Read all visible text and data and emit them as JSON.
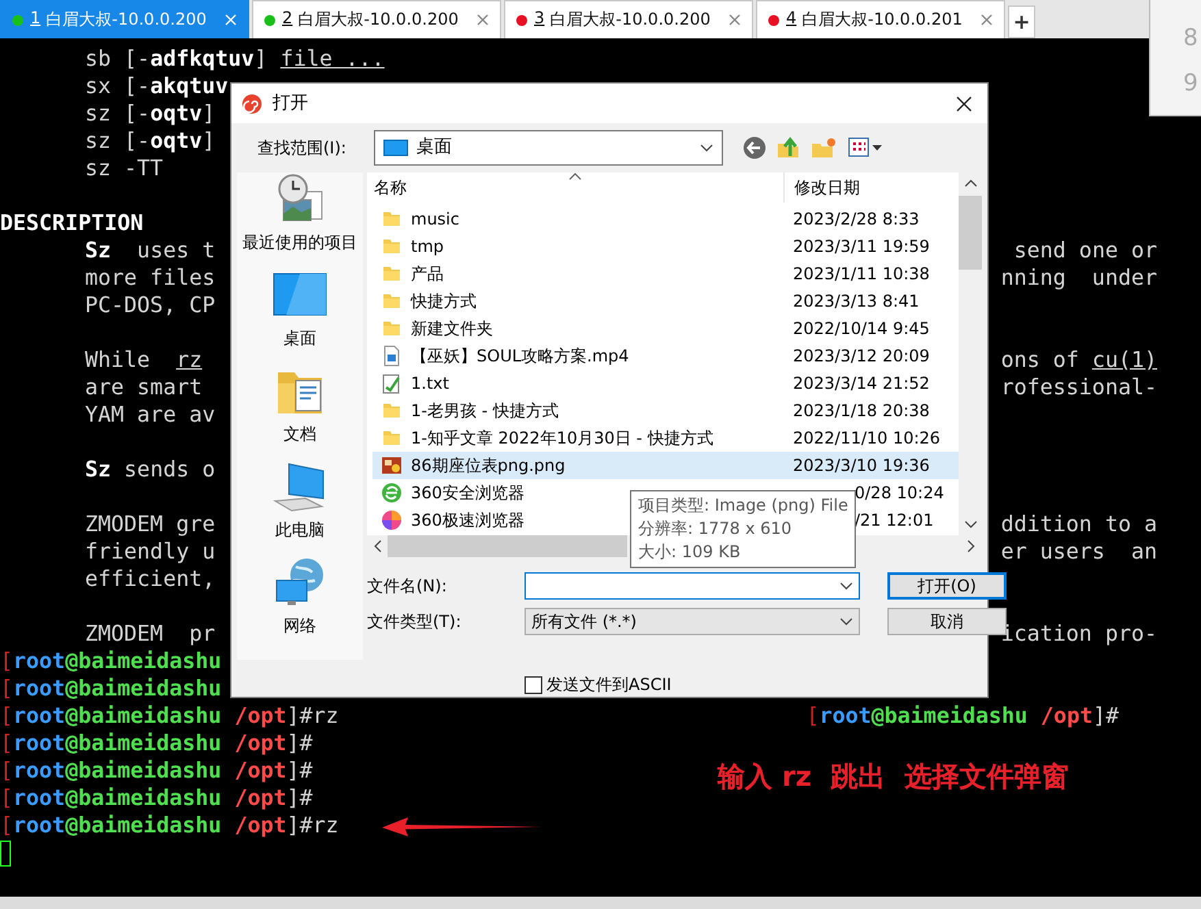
{
  "tabs": [
    {
      "number": "1",
      "title": "白眉大叔-10.0.0.200",
      "color": "#19c019",
      "selected": true
    },
    {
      "number": "2",
      "title": "白眉大叔-10.0.0.200",
      "color": "#19c019",
      "selected": false
    },
    {
      "number": "3",
      "title": "白眉大叔-10.0.0.200",
      "color": "#e81123",
      "selected": false
    },
    {
      "number": "4",
      "title": "白眉大叔-10.0.0.201",
      "color": "#e81123",
      "selected": false
    }
  ],
  "new_tab": "+",
  "side_panel": {
    "numbers": [
      "8",
      "9"
    ]
  },
  "terminal": {
    "blocks": [
      {
        "lines": [
          {
            "kind": "text",
            "left": [
              {
                "text": "sb [-",
                "kind": "plain"
              },
              {
                "text": "adfkqtuv",
                "kind": "bold"
              },
              {
                "text": "] ",
                "kind": "plain"
              },
              {
                "text": "file ...",
                "kind": "underlined"
              }
            ]
          },
          {
            "kind": "text",
            "left": [
              {
                "text": "sx [-",
                "kind": "plain"
              },
              {
                "text": "akqtuv",
                "kind": "bold"
              }
            ]
          },
          {
            "kind": "text",
            "left": [
              {
                "text": "sz [-",
                "kind": "plain"
              },
              {
                "text": "oqtv",
                "kind": "bold"
              },
              {
                "text": "]",
                "kind": "plain"
              }
            ]
          },
          {
            "kind": "text",
            "left": [
              {
                "text": "sz [-",
                "kind": "plain"
              },
              {
                "text": "oqtv",
                "kind": "bold"
              },
              {
                "text": "]",
                "kind": "plain"
              }
            ]
          },
          {
            "kind": "text",
            "left": [
              {
                "text": "sz -TT",
                "kind": "plain"
              }
            ]
          }
        ]
      },
      {
        "lines": [
          {
            "kind": "heading",
            "left": [
              {
                "text": "DESCRIPTION",
                "kind": "bold"
              }
            ]
          },
          {
            "kind": "text",
            "left": [
              {
                "text": "Sz",
                "kind": "bold"
              },
              {
                "text": "  uses t",
                "kind": "plain"
              }
            ],
            "right": {
              "kind": "wrap",
              "parts": [
                {
                  "text": "send one or",
                  "kind": "plain"
                }
              ]
            }
          },
          {
            "kind": "text",
            "left": [
              {
                "text": "more files",
                "kind": "plain"
              }
            ],
            "right": {
              "kind": "wrap",
              "parts": [
                {
                  "text": "nning  under",
                  "kind": "plain"
                }
              ]
            }
          },
          {
            "kind": "text",
            "left": [
              {
                "text": "PC-DOS, CP",
                "kind": "plain"
              }
            ]
          }
        ]
      },
      {
        "lines": [
          {
            "kind": "text",
            "left": [
              {
                "text": "While  ",
                "kind": "plain"
              },
              {
                "text": "rz",
                "kind": "underlined"
              }
            ],
            "right": {
              "kind": "wrap",
              "parts": [
                {
                  "text": "ons of ",
                  "kind": "plain"
                },
                {
                  "text": "cu(1)",
                  "kind": "underlined"
                }
              ]
            }
          },
          {
            "kind": "text",
            "left": [
              {
                "text": "are smart",
                "kind": "plain"
              }
            ],
            "right": {
              "kind": "wrap",
              "parts": [
                {
                  "text": "rofessional-",
                  "kind": "plain"
                }
              ]
            }
          },
          {
            "kind": "text",
            "left": [
              {
                "text": "YAM are av",
                "kind": "plain"
              }
            ]
          }
        ]
      },
      {
        "lines": [
          {
            "kind": "text",
            "left": [
              {
                "text": "Sz",
                "kind": "bold"
              },
              {
                "text": " sends o",
                "kind": "plain"
              }
            ]
          }
        ]
      },
      {
        "lines": [
          {
            "kind": "text",
            "left": [
              {
                "text": "ZMODEM gre",
                "kind": "plain"
              }
            ],
            "right": {
              "kind": "wrap",
              "parts": [
                {
                  "text": "ddition to a",
                  "kind": "plain"
                }
              ]
            }
          },
          {
            "kind": "text",
            "left": [
              {
                "text": "friendly u",
                "kind": "plain"
              }
            ],
            "right": {
              "kind": "wrap",
              "parts": [
                {
                  "text": "er users  an",
                  "kind": "plain"
                }
              ]
            }
          },
          {
            "kind": "text",
            "left": [
              {
                "text": "efficient,",
                "kind": "plain"
              }
            ]
          }
        ]
      },
      {
        "lines": [
          {
            "kind": "text",
            "left": [
              {
                "text": "ZMODEM  pr",
                "kind": "plain"
              }
            ],
            "right": {
              "kind": "wrap",
              "parts": [
                {
                  "text": "ication pro-",
                  "kind": "plain"
                }
              ]
            }
          },
          {
            "kind": "prompt",
            "left": [
              {
                "text": "[",
                "kind": "bracket"
              },
              {
                "text": "root",
                "kind": "user"
              },
              {
                "text": "@baimeidashu",
                "kind": "host"
              }
            ]
          },
          {
            "kind": "prompt",
            "left": [
              {
                "text": "[",
                "kind": "bracket"
              },
              {
                "text": "root",
                "kind": "user"
              },
              {
                "text": "@baimeidashu",
                "kind": "host"
              }
            ]
          },
          {
            "kind": "prompt",
            "left": [
              {
                "text": "[",
                "kind": "bracket"
              },
              {
                "text": "root",
                "kind": "user"
              },
              {
                "text": "@baimeidashu",
                "kind": "host"
              },
              {
                "text": " /opt",
                "kind": "path"
              },
              {
                "text": "]#rz",
                "kind": "plain"
              }
            ],
            "right": {
              "kind": "prompt",
              "parts": [
                {
                  "text": "[",
                  "kind": "bracket"
                },
                {
                  "text": "root",
                  "kind": "user"
                },
                {
                  "text": "@baimeidashu",
                  "kind": "host"
                },
                {
                  "text": " /opt",
                  "kind": "path"
                },
                {
                  "text": "]#",
                  "kind": "plain"
                }
              ]
            }
          },
          {
            "kind": "prompt",
            "left": [
              {
                "text": "[",
                "kind": "bracket"
              },
              {
                "text": "root",
                "kind": "user"
              },
              {
                "text": "@baimeidashu",
                "kind": "host"
              },
              {
                "text": " /opt",
                "kind": "path"
              },
              {
                "text": "]#",
                "kind": "plain"
              }
            ]
          },
          {
            "kind": "prompt",
            "left": [
              {
                "text": "[",
                "kind": "bracket"
              },
              {
                "text": "root",
                "kind": "user"
              },
              {
                "text": "@baimeidashu",
                "kind": "host"
              },
              {
                "text": " /opt",
                "kind": "path"
              },
              {
                "text": "]#",
                "kind": "plain"
              }
            ]
          },
          {
            "kind": "prompt",
            "left": [
              {
                "text": "[",
                "kind": "bracket"
              },
              {
                "text": "root",
                "kind": "user"
              },
              {
                "text": "@baimeidashu",
                "kind": "host"
              },
              {
                "text": " /opt",
                "kind": "path"
              },
              {
                "text": "]#",
                "kind": "plain"
              }
            ]
          },
          {
            "kind": "prompt",
            "left": [
              {
                "text": "[",
                "kind": "bracket"
              },
              {
                "text": "root",
                "kind": "user"
              },
              {
                "text": "@baimeidashu",
                "kind": "host"
              },
              {
                "text": " /opt",
                "kind": "path"
              },
              {
                "text": "]#rz",
                "kind": "plain"
              }
            ]
          }
        ]
      }
    ],
    "cursor": true
  },
  "dialog": {
    "title": "打开",
    "look_in_label": "查找范围(I):",
    "look_in_value": "桌面",
    "places": [
      {
        "kind": "recent",
        "label": "最近使用的项目"
      },
      {
        "kind": "desktop",
        "label": "桌面"
      },
      {
        "kind": "documents",
        "label": "文档"
      },
      {
        "kind": "computer",
        "label": "此电脑"
      },
      {
        "kind": "network",
        "label": "网络"
      }
    ],
    "columns": [
      "名称",
      "修改日期"
    ],
    "files": [
      {
        "kind": "folder",
        "name": "music",
        "date": "2023/2/28 8:33",
        "date_partial": false,
        "selected": false
      },
      {
        "kind": "folder",
        "name": "tmp",
        "date": "2023/3/11 19:59",
        "date_partial": false,
        "selected": false
      },
      {
        "kind": "folder",
        "name": "产品",
        "date": "2023/1/11 10:38",
        "date_partial": false,
        "selected": false
      },
      {
        "kind": "folder",
        "name": "快捷方式",
        "date": "2023/3/13 8:41",
        "date_partial": false,
        "selected": false
      },
      {
        "kind": "folder",
        "name": "新建文件夹",
        "date": "2022/10/14 9:45",
        "date_partial": false,
        "selected": false
      },
      {
        "kind": "video",
        "name": "【巫妖】SOUL攻略方案.mp4",
        "date": "2023/3/12 20:09",
        "date_partial": false,
        "selected": false
      },
      {
        "kind": "text",
        "name": "1.txt",
        "date": "2023/3/14 21:52",
        "date_partial": false,
        "selected": false
      },
      {
        "kind": "folder",
        "name": "1-老男孩 - 快捷方式",
        "date": "2023/1/18 20:38",
        "date_partial": false,
        "selected": false
      },
      {
        "kind": "folder",
        "name": "1-知乎文章 2022年10月30日 - 快捷方式",
        "date": "2022/11/10 10:26",
        "date_partial": false,
        "selected": false
      },
      {
        "kind": "image",
        "name": "86期座位表png.png",
        "date": "2023/3/10 19:36",
        "date_partial": false,
        "selected": true
      },
      {
        "kind": "browser",
        "name": "360安全浏览器",
        "date": "0/28 10:24",
        "date_partial": true,
        "selected": false
      },
      {
        "kind": "browser_fast",
        "name": "360极速浏览器",
        "date": "/21 12:01",
        "date_partial": true,
        "selected": false
      }
    ],
    "tooltip": [
      "项目类型: Image (png) File",
      "分辨率: 1778 x 610",
      "大小: 109 KB"
    ],
    "file_name_label": "文件名(N):",
    "open_button": "打开(O)",
    "file_type_label": "文件类型(T):",
    "file_type_value": "所有文件 (*.*)",
    "cancel_button": "取消",
    "ascii_checkbox": {
      "label": "发送文件到ASCII",
      "checked": false
    }
  },
  "annotation": {
    "note": "输入 rz  跳出  选择文件弹窗"
  }
}
